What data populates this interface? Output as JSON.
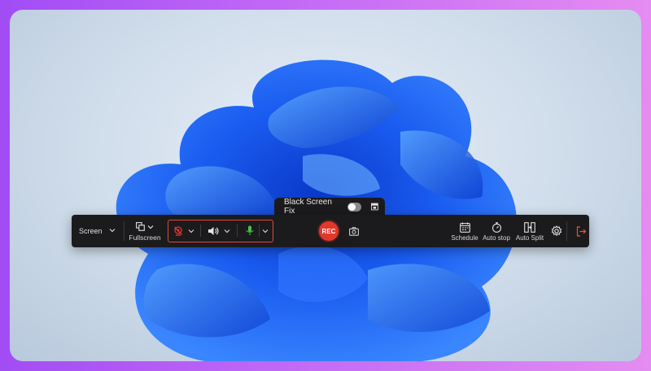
{
  "colors": {
    "frame_gradient_left": "#a24cf5",
    "frame_gradient_right": "#e58cf2",
    "toolbar_bg": "#1b1b1d",
    "accent_red": "#e2372d",
    "highlight_border": "#e2483a",
    "mic_green": "#4cc04a",
    "exit_orange": "#e8553b"
  },
  "black_screen_fix": {
    "label": "Black Screen Fix",
    "toggle_on": false,
    "icon": "window-icon"
  },
  "toolbar": {
    "screen_select": {
      "value": "Screen",
      "icon": "chevron-down-icon"
    },
    "fullscreen": {
      "label": "Fullscreen",
      "icon": "region-select-icon"
    },
    "media": {
      "webcam": {
        "icon": "webcam-off-icon",
        "enabled": false
      },
      "system_audio": {
        "icon": "speaker-icon",
        "enabled": true
      },
      "microphone": {
        "icon": "microphone-icon",
        "enabled": true
      }
    },
    "rec_label": "REC",
    "snapshot_icon": "camera-icon",
    "schedule_label": "Schedule",
    "auto_stop_label": "Auto stop",
    "auto_split_label": "Auto Split",
    "settings_icon": "gear-icon",
    "exit_icon": "exit-icon"
  }
}
